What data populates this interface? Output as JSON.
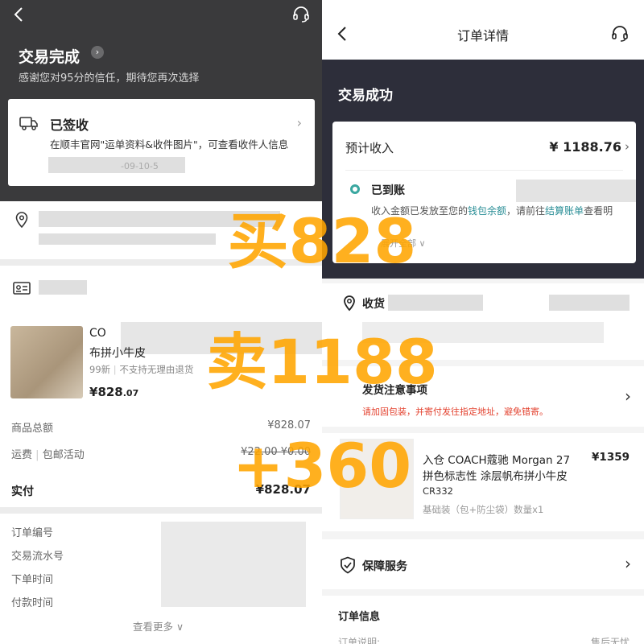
{
  "left": {
    "status_title": "交易完成",
    "status_arrow": "›",
    "thanks": "感谢您对95分的信任，期待您再次选择",
    "delivery": {
      "status": "已签收",
      "info": "在顺丰官网\"运单资料&收件图片\"，可查看收件人信息",
      "date_partial": "-09-10-5"
    },
    "product": {
      "brand_partial": "CO",
      "name_partial": "布拼小牛皮",
      "condition": "99新",
      "policy": "不支持无理由退货",
      "price_symbol": "¥",
      "price_main": "828",
      "price_decimal": ".07"
    },
    "summary": [
      {
        "label": "商品总额",
        "value": "¥828.07",
        "strike": false
      },
      {
        "label": "运费",
        "label_extra": "包邮活动",
        "value": "¥22.00 ¥0.00",
        "strike": true
      }
    ],
    "paid_label": "实付",
    "paid_value": "¥828.07",
    "order_fields": [
      "订单编号",
      "交易流水号",
      "下单时间",
      "付款时间"
    ],
    "see_more": "查看更多 ∨"
  },
  "right": {
    "nav_title": "订单详情",
    "status": "交易成功",
    "income_label": "预计收入",
    "income_value": "¥ 1188.76",
    "arrived": "已到账",
    "arrived_line_a": "收入金额已发放至您的",
    "arrived_link1": "钱包余额",
    "arrived_line_b": "，请前往",
    "arrived_link2": "结算账单",
    "arrived_line_c": "查看明",
    "arrived_more": "展开全部 ∨",
    "receiver_label": "收货",
    "ship_title": "发货注意事项",
    "ship_warning": "请加固包装，并寄付发往指定地址，避免错寄。",
    "product": {
      "name_line1": "入仓 COACH蔻驰 Morgan 27",
      "name_line2": "拼色标志性 涂层帆布拼小牛皮",
      "price": "¥1359",
      "code": "CR332",
      "spec": "基础装（包+防尘袋）数量x1"
    },
    "guarantee": "保障服务",
    "order_info": "订单信息",
    "order_desc_label": "订单说明:",
    "order_desc_value": "售后无忧"
  },
  "overlay": {
    "buy": "买828",
    "sell": "卖1188",
    "profit": "+360"
  },
  "colors": {
    "left_dark": "#3a3a3c",
    "right_dark": "#2d2e3a",
    "teal": "#3aa7a0",
    "warning_red": "#e3422f",
    "overlay_orange": "#ffa500"
  }
}
